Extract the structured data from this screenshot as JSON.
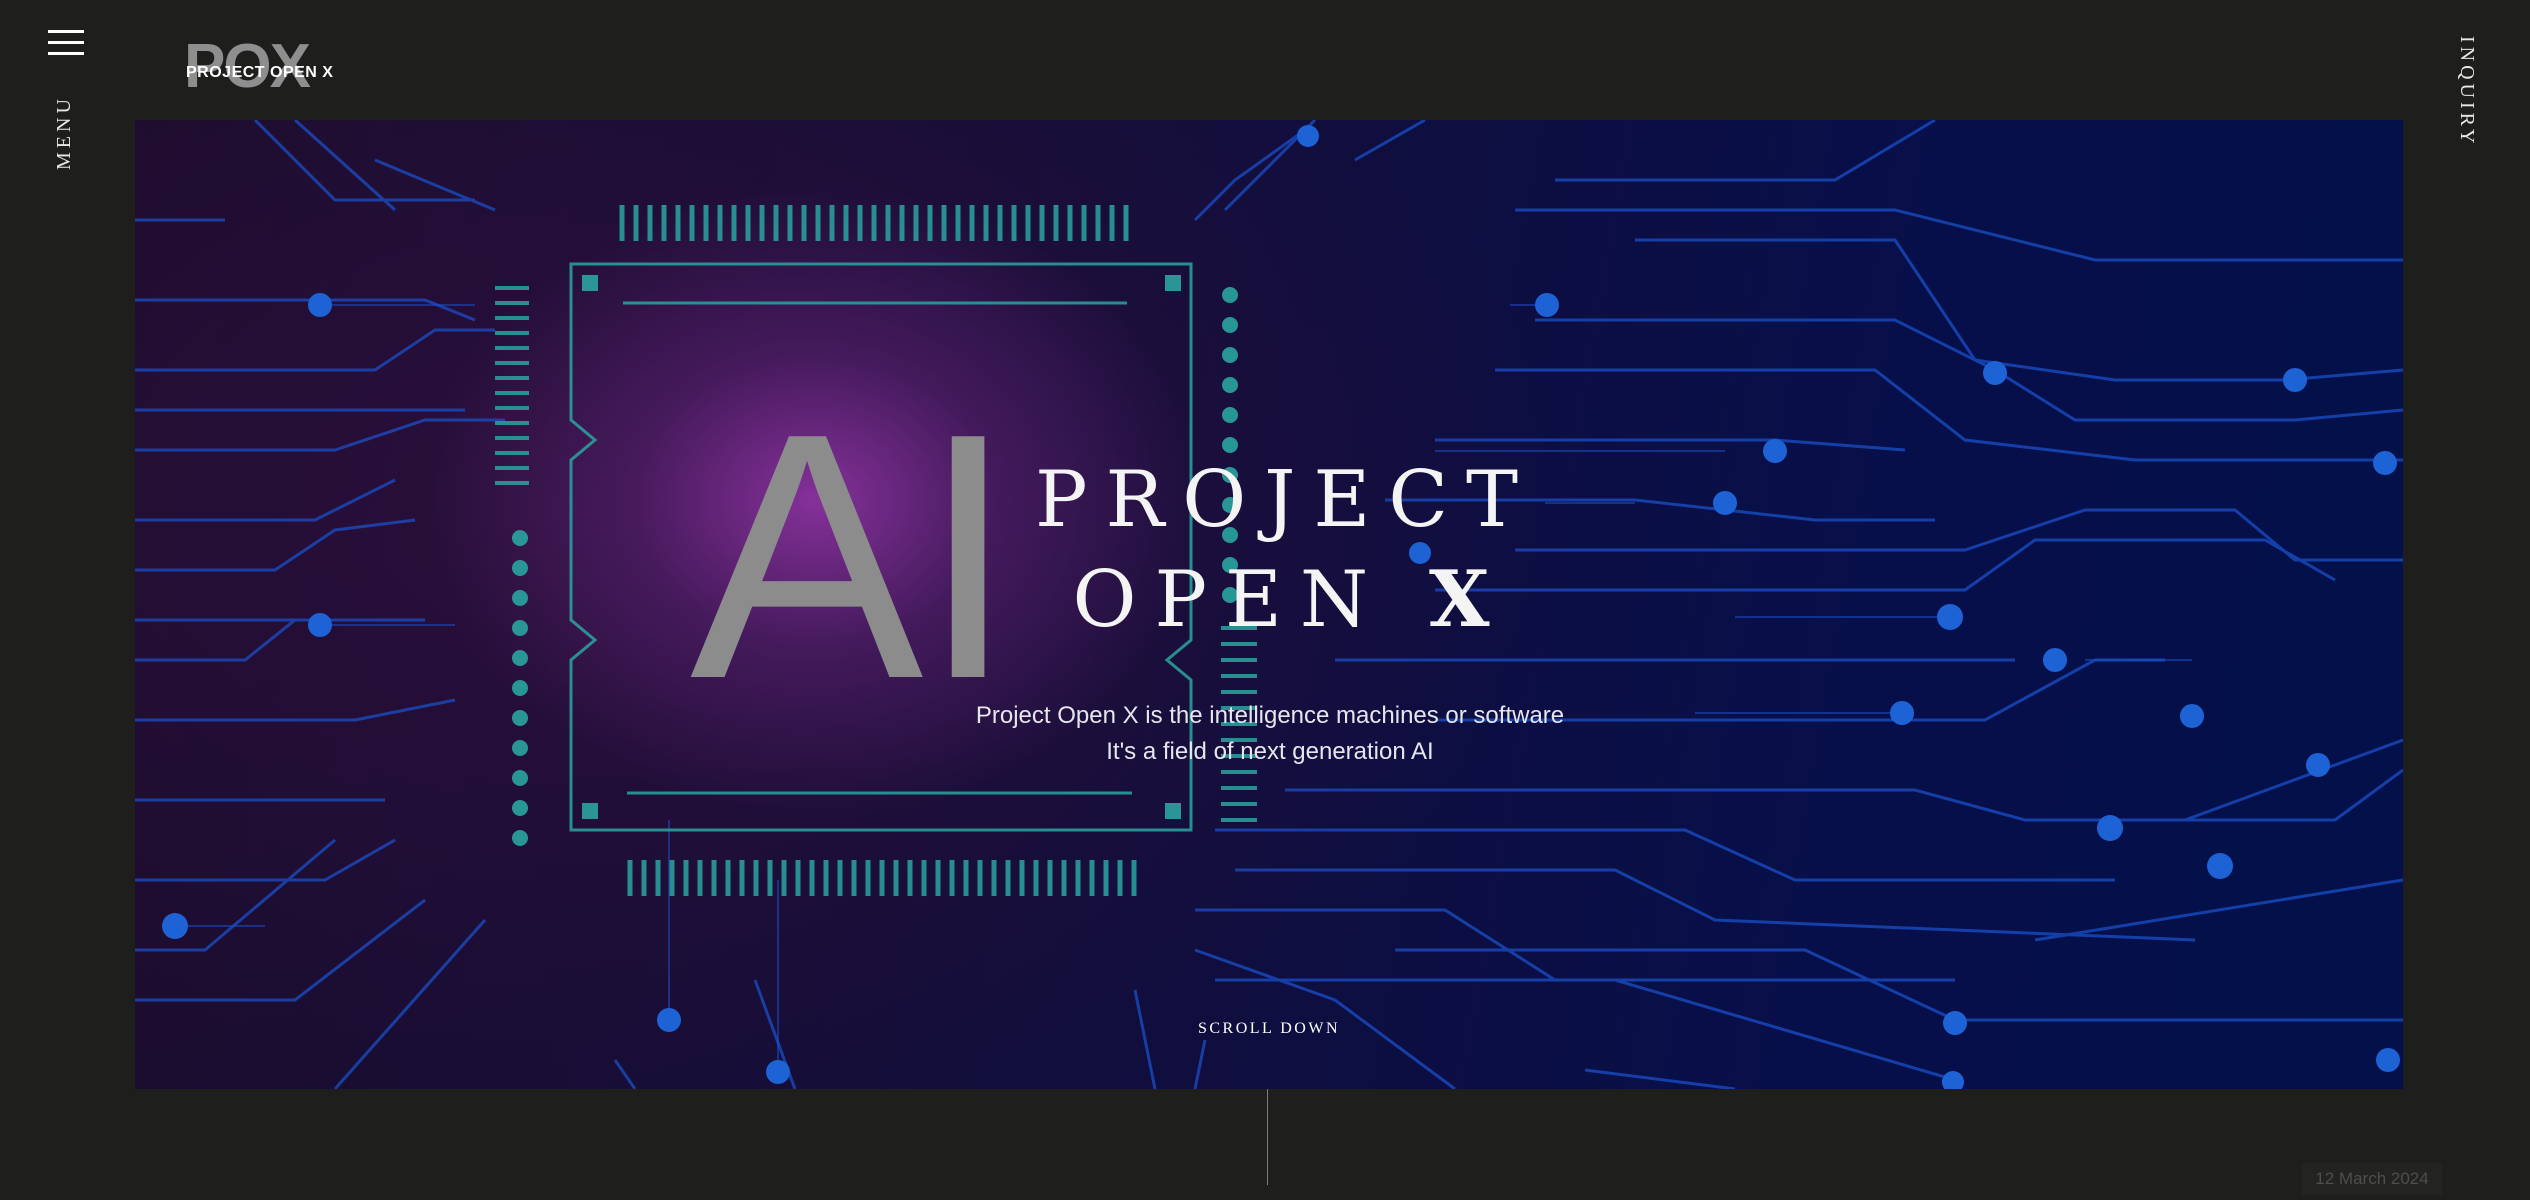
{
  "nav": {
    "menu_label": "MENU",
    "inquiry_label": "INQUIRY"
  },
  "logo": {
    "mark": "POX",
    "text": "PROJECT OPEN X"
  },
  "hero": {
    "ai_text": "AI",
    "title_line1": "PROJECT",
    "title_line2_prefix": "OPEN",
    "title_line2_emphasis": "X",
    "subtitle_line1": "Project Open X is the intelligence machines or software",
    "subtitle_line2": "It's a field of next generation AI",
    "scroll_label": "SCROLL DOWN"
  },
  "footer": {
    "date": "12 March 2024"
  },
  "colors": {
    "background": "#1e1e1c",
    "chip_teal": "#2aa5a0",
    "circuit_blue": "#1a4fc8",
    "node_blue": "#1e63d6",
    "glow_purple": "#9637aa"
  },
  "icons": {
    "menu": "hamburger-icon",
    "circuit": "circuit-board-illustration"
  }
}
